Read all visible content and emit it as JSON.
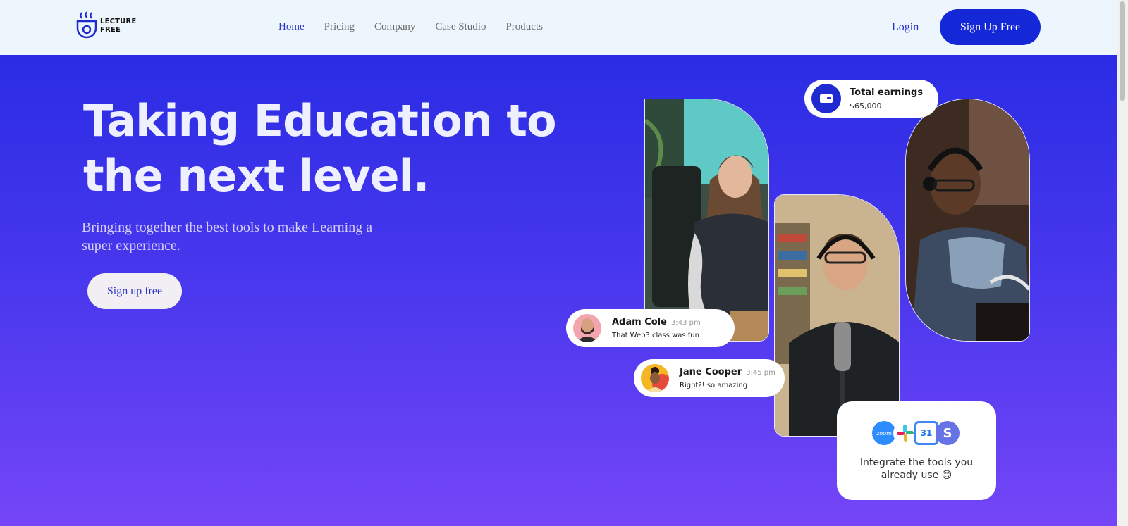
{
  "header": {
    "logo_line1": "LECTURE",
    "logo_line2": "FREE",
    "nav": [
      {
        "label": "Home"
      },
      {
        "label": "Pricing"
      },
      {
        "label": "Company"
      },
      {
        "label": "Case Studio"
      },
      {
        "label": "Products"
      }
    ],
    "login_label": "Login",
    "signup_label": "Sign Up Free"
  },
  "hero": {
    "title": "Taking Education to the next level.",
    "subtitle": "Bringing together the best tools to make Learning a super experience.",
    "cta_label": "Sign up free"
  },
  "earnings": {
    "title": "Total earnings",
    "amount": "$65,000"
  },
  "chats": [
    {
      "name": "Adam Cole",
      "time": "3:43 pm",
      "message": "That Web3 class was fun"
    },
    {
      "name": "Jane Cooper",
      "time": "3:45 pm",
      "message": "Right?! so amazing"
    }
  ],
  "integrations": {
    "text": "Integrate the tools you already use 😊",
    "tools": [
      {
        "icon": "zoom-icon",
        "label": "zoom"
      },
      {
        "icon": "slack-icon",
        "label": ""
      },
      {
        "icon": "calendar-icon",
        "label": "31"
      },
      {
        "icon": "stripe-icon",
        "label": "S"
      }
    ]
  },
  "colors": {
    "brand_blue": "#1428d8",
    "hero_top": "#2a2ce4",
    "hero_bottom": "#7546f7",
    "nav_active": "#2a35c9"
  }
}
